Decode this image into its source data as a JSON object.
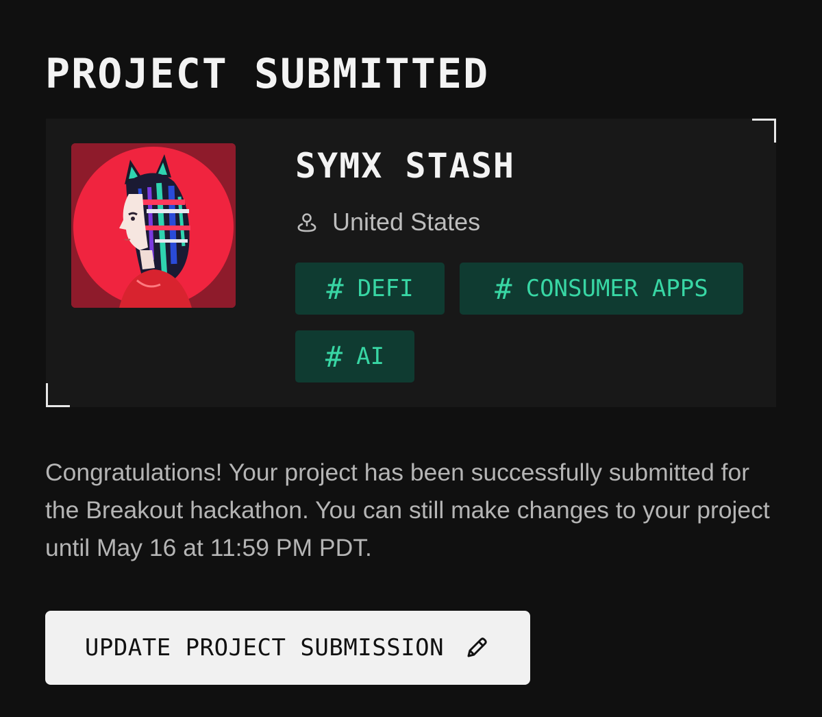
{
  "page": {
    "title": "PROJECT SUBMITTED"
  },
  "project": {
    "name": "SYMX STASH",
    "location": "United States",
    "location_icon": "location-pin-icon",
    "avatar": "anime-girl-avatar",
    "tags": [
      {
        "hash": "#",
        "label": "DEFI"
      },
      {
        "hash": "#",
        "label": "CONSUMER APPS"
      },
      {
        "hash": "#",
        "label": "AI"
      }
    ]
  },
  "message": "Congratulations! Your project has been successfully submitted for the Breakout hackathon. You can still make changes to your project until May 16 at 11:59 PM PDT.",
  "actions": {
    "update_label": "UPDATE PROJECT SUBMISSION",
    "update_icon": "pencil-icon"
  },
  "colors": {
    "background": "#101010",
    "card": "#181818",
    "tag_bg": "#0f3b31",
    "tag_text": "#38d6a4",
    "button_bg": "#f1f1f1"
  }
}
